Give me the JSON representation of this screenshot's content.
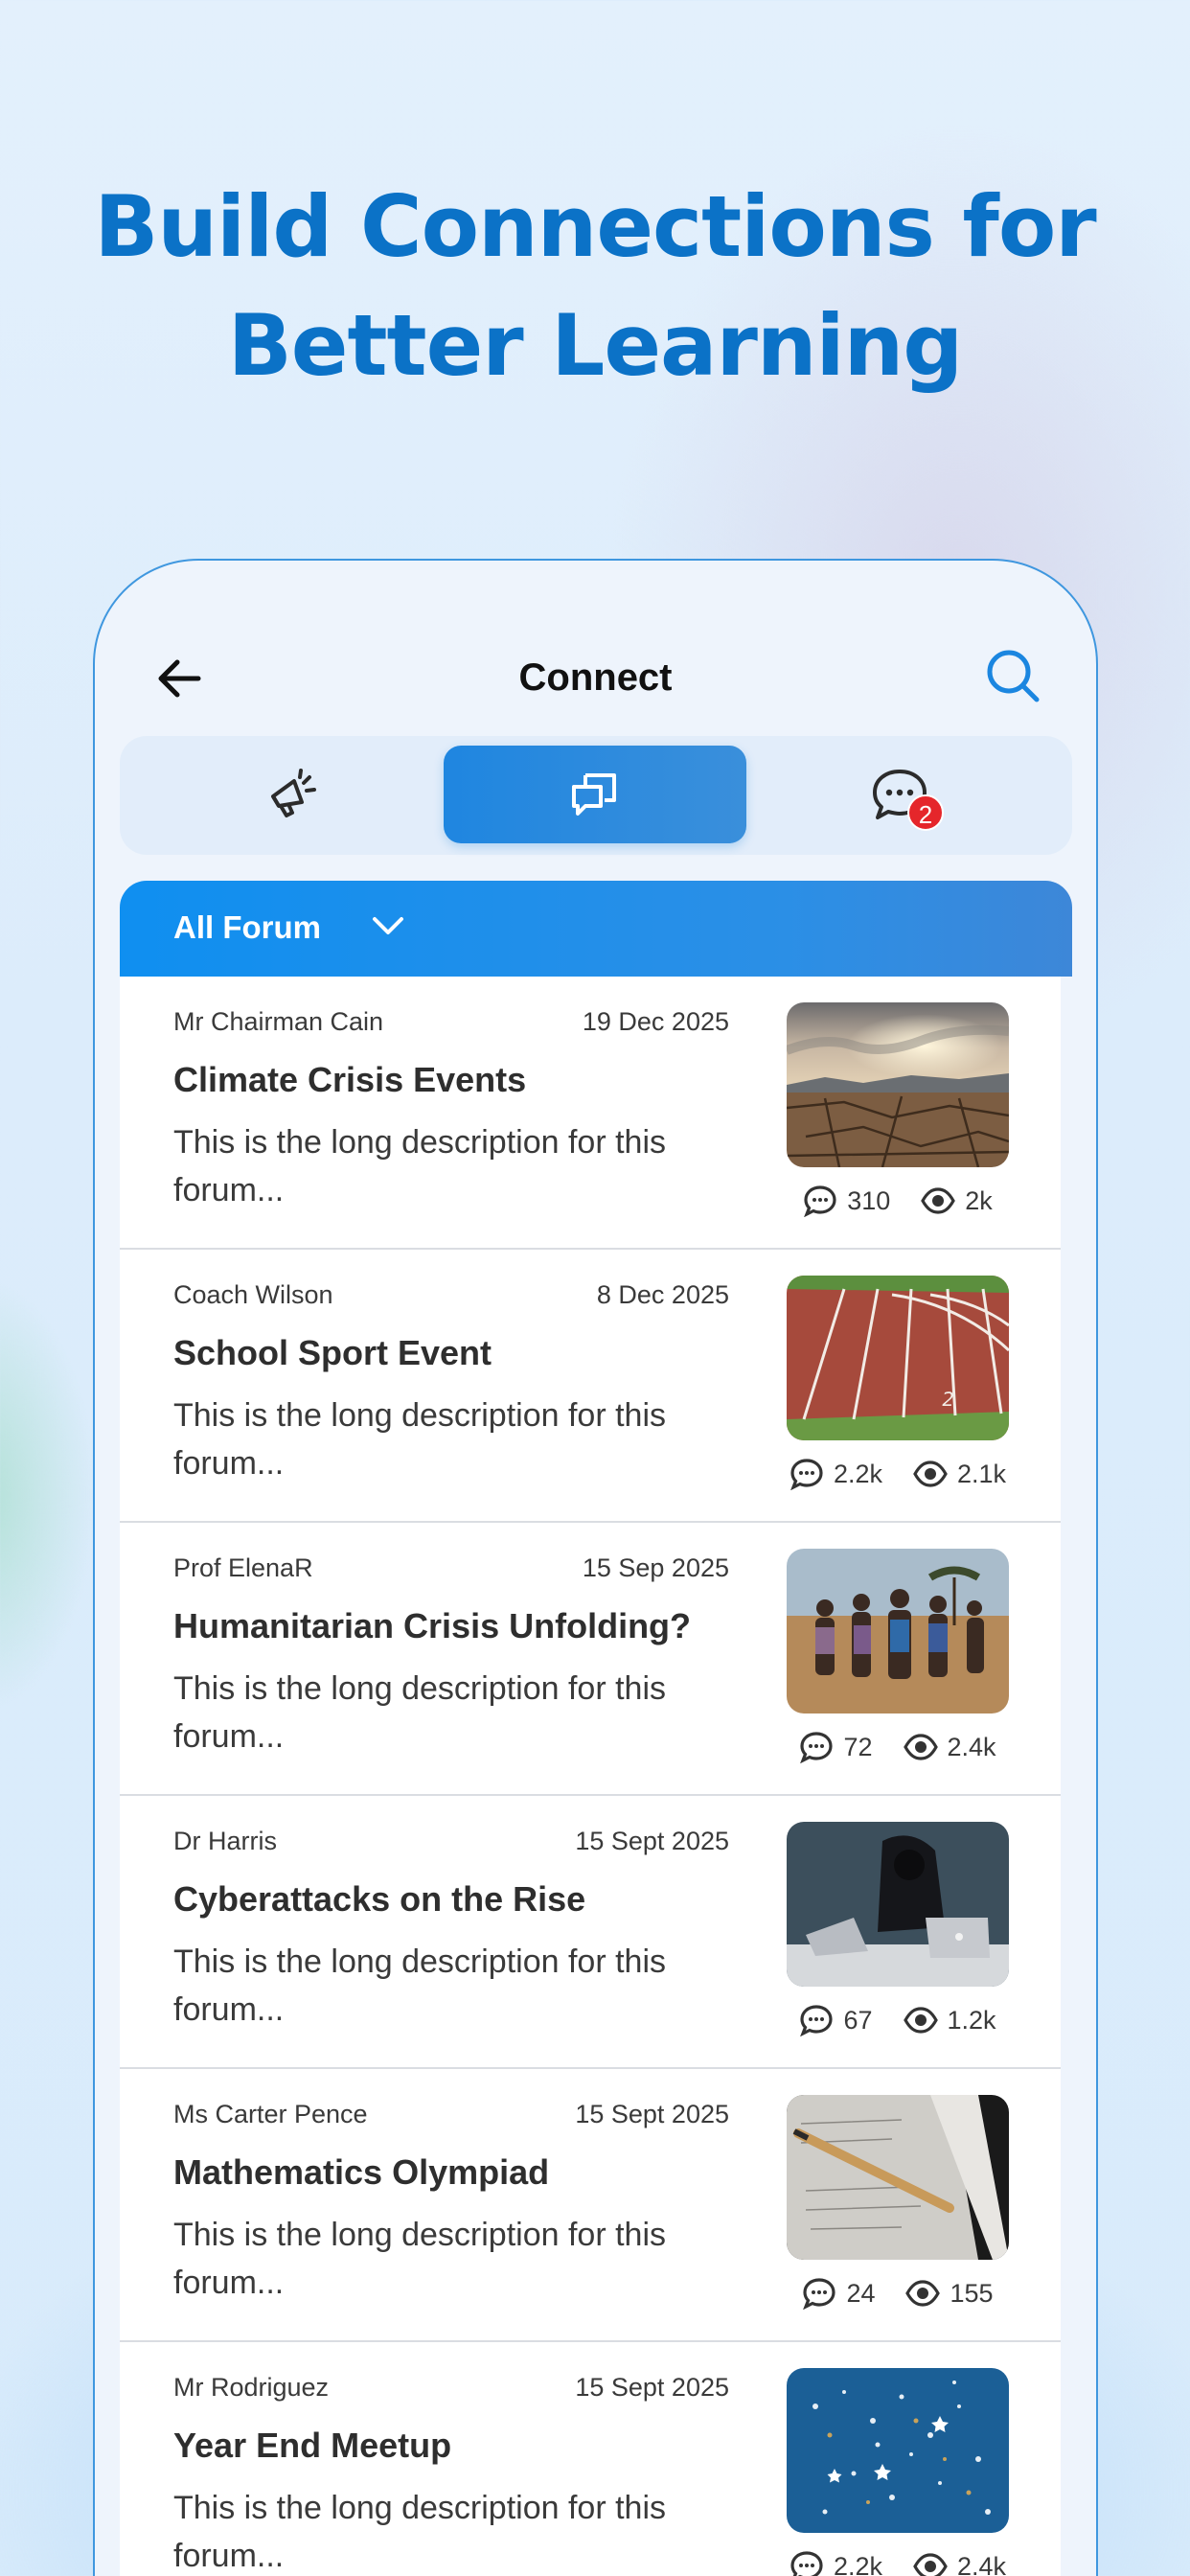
{
  "headline": [
    "Build Connections for",
    "Better Learning"
  ],
  "screen": {
    "title": "Connect",
    "tabs": [
      {
        "name": "announcements",
        "icon": "megaphone-icon"
      },
      {
        "name": "forum",
        "icon": "forum-icon",
        "active": true
      },
      {
        "name": "messages",
        "icon": "chat-icon",
        "badge": "2"
      }
    ],
    "filter_label": "All Forum",
    "accent": "#1f86e0",
    "badge_color": "#e5262b"
  },
  "forums": [
    {
      "author": "Mr Chairman Cain",
      "date": "19 Dec 2025",
      "title": "Climate Crisis Events",
      "desc": "This is the long description for this forum...",
      "comments": "310",
      "views": "2k",
      "image": "cracked-earth-photo"
    },
    {
      "author": "Coach Wilson",
      "date": "8 Dec 2025",
      "title": "School Sport Event",
      "desc": "This is the long description for this forum...",
      "comments": "2.2k",
      "views": "2.1k",
      "image": "running-track-photo"
    },
    {
      "author": "Prof ElenaR",
      "date": "15 Sep 2025",
      "title": "Humanitarian Crisis Unfolding?",
      "desc": "This is the long description for this forum...",
      "comments": "72",
      "views": "2.4k",
      "image": "children-photo"
    },
    {
      "author": "Dr Harris",
      "date": "15 Sept 2025",
      "title": "Cyberattacks on the Rise",
      "desc": "This is the long description for this forum...",
      "comments": "67",
      "views": "1.2k",
      "image": "hacker-laptop-photo"
    },
    {
      "author": "Ms Carter Pence",
      "date": "15 Sept 2025",
      "title": "Mathematics Olympiad",
      "desc": "This is the long description for this forum...",
      "comments": "24",
      "views": "155",
      "image": "pen-paper-photo"
    },
    {
      "author": "Mr Rodriguez",
      "date": "15 Sept 2025",
      "title": "Year End Meetup",
      "desc": "This is the long description for this forum...",
      "comments": "2.2k",
      "views": "2.4k",
      "image": "confetti-photo"
    }
  ]
}
